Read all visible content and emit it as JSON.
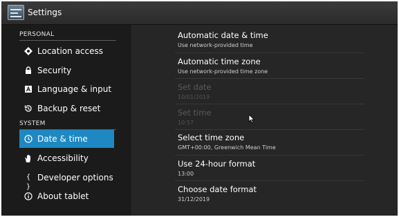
{
  "app": {
    "title": "Settings",
    "icon": "settings-sliders-icon"
  },
  "sidebar": {
    "sections": [
      {
        "header": "PERSONAL"
      },
      {
        "header": "SYSTEM"
      }
    ],
    "items": [
      {
        "label": "Location access",
        "icon": "location-icon"
      },
      {
        "label": "Security",
        "icon": "lock-icon"
      },
      {
        "label": "Language & input",
        "icon": "keyboard-letter-icon"
      },
      {
        "label": "Backup & reset",
        "icon": "restore-icon"
      },
      {
        "label": "Date & time",
        "icon": "clock-icon",
        "selected": true
      },
      {
        "label": "Accessibility",
        "icon": "hand-icon"
      },
      {
        "label": "Developer options",
        "icon": "braces-icon"
      },
      {
        "label": "About tablet",
        "icon": "info-icon"
      }
    ],
    "selected_color": "#1e88c3"
  },
  "datetime": {
    "prefs": [
      {
        "title": "Automatic date & time",
        "summary": "Use network-provided time",
        "checkbox": true,
        "checked": true,
        "enabled": true
      },
      {
        "title": "Automatic time zone",
        "summary": "Use network-provided time zone",
        "checkbox": true,
        "checked": false,
        "enabled": true
      },
      {
        "title": "Set date",
        "summary": "10/01/2019",
        "enabled": false
      },
      {
        "title": "Set time",
        "summary": "10:57",
        "enabled": false
      },
      {
        "title": "Select time zone",
        "summary": "GMT+00:00, Greenwich Mean Time",
        "enabled": true
      },
      {
        "title": "Use 24-hour format",
        "summary": "13:00",
        "checkbox": true,
        "checked": true,
        "enabled": true
      },
      {
        "title": "Choose date format",
        "summary": "31/12/2019",
        "enabled": true
      }
    ]
  }
}
